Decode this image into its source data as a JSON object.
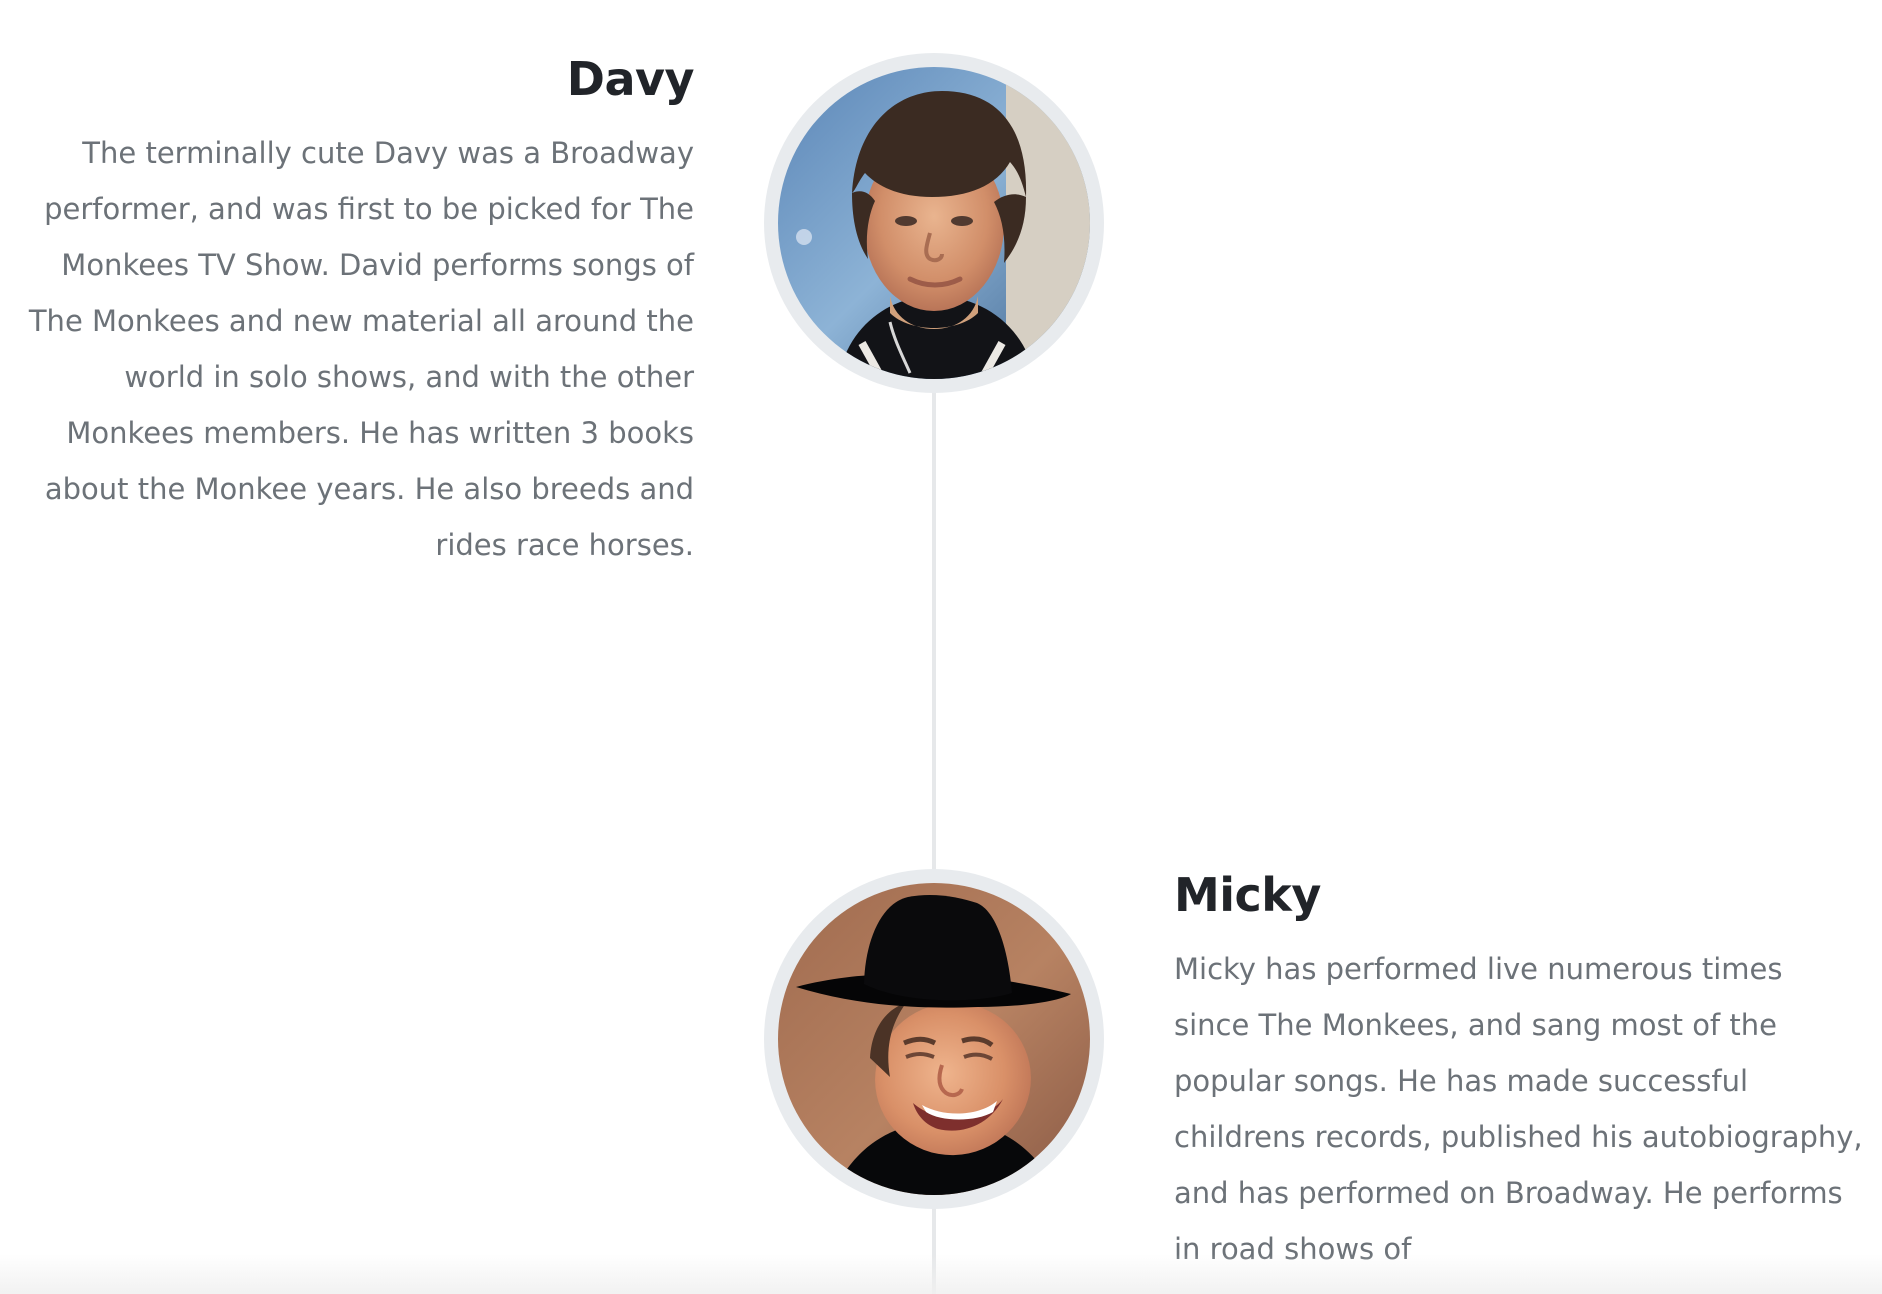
{
  "timeline": {
    "members": [
      {
        "name": "Davy",
        "bio": "The terminally cute Davy was a Broadway performer, and was first to be picked for The Monkees TV Show. David performs songs of The Monkees and new material all around the world in solo shows, and with the other Monkees members. He has written 3 books about the Monkee years. He also breeds and rides race horses.",
        "side": "left"
      },
      {
        "name": "Micky",
        "bio": "Micky has performed live numerous times since The Monkees, and sang most of the popular songs. He has made successful childrens records, published his autobiography, and has performed on Broadway. He performs in road shows of",
        "side": "right"
      }
    ]
  }
}
